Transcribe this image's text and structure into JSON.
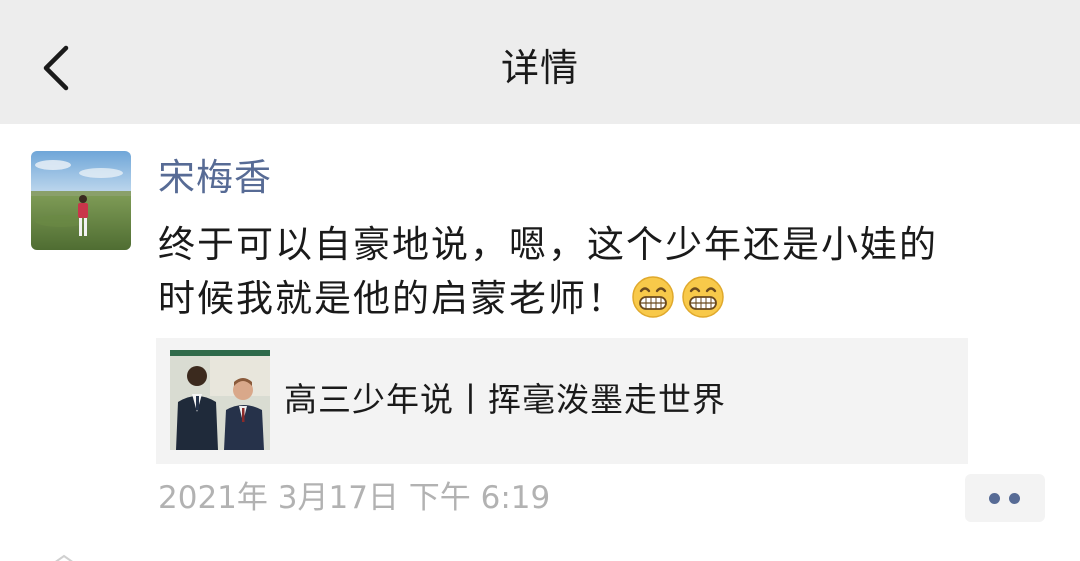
{
  "header": {
    "title": "详情"
  },
  "post": {
    "author": "宋梅香",
    "text_lines": [
      "终于可以自豪地说，嗯，这个少年还是小娃的",
      "时候我就是他的启蒙老师！"
    ],
    "emojis": [
      "grin-emoji",
      "grin-emoji"
    ],
    "link_card": {
      "title": "高三少年说丨挥毫泼墨走世界"
    },
    "timestamp": "2021年 3月17日 下午 6:19"
  },
  "icons": {
    "back": "chevron-left-icon",
    "more": "more-dots-icon"
  },
  "colors": {
    "header_bg": "#ededed",
    "name_link": "#576b95",
    "card_bg": "#f3f3f3",
    "timestamp": "#b2b2b2"
  }
}
